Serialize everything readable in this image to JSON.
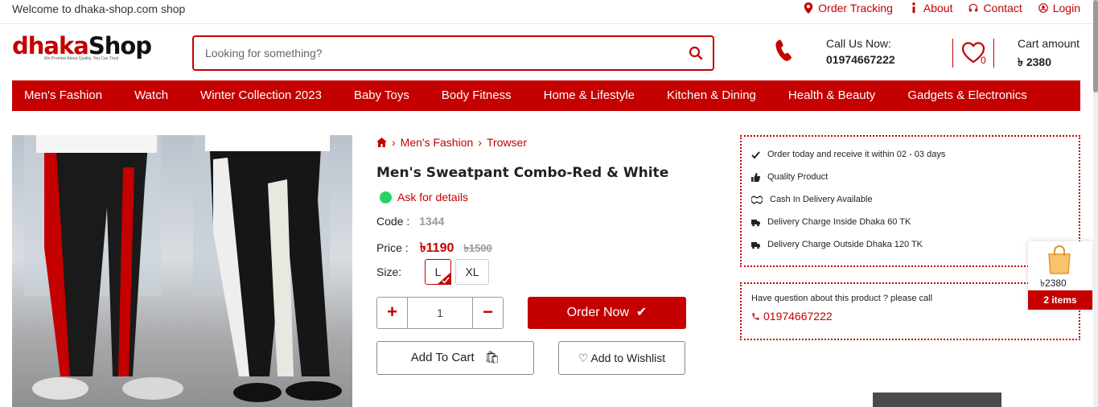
{
  "topbar": {
    "welcome": "Welcome to dhaka-shop.com shop",
    "links": [
      {
        "label": "Order Tracking",
        "icon": "map-marker-icon"
      },
      {
        "label": "About",
        "icon": "info-icon"
      },
      {
        "label": "Contact",
        "icon": "headset-icon"
      },
      {
        "label": "Login",
        "icon": "user-icon"
      }
    ]
  },
  "header": {
    "logo_part1": "dhaka",
    "logo_part2": "Shop",
    "logo_tagline": "We Promise About Quality, You Can Trust",
    "search_placeholder": "Looking for something?",
    "call_label": "Call Us Now:",
    "call_number": "01974667222",
    "wishlist_count": "0",
    "cart_label": "Cart amount",
    "cart_value": "৳ 2380"
  },
  "nav": {
    "items": [
      "Men's Fashion",
      "Watch",
      "Winter Collection 2023",
      "Baby Toys",
      "Body Fitness",
      "Home & Lifestyle",
      "Kitchen & Dining",
      "Health & Beauty",
      "Gadgets & Electronics"
    ]
  },
  "product": {
    "breadcrumb": [
      "Men's Fashion",
      "Trowser"
    ],
    "title": "Men's Sweatpant Combo-Red & White",
    "ask": "Ask for details",
    "code_label": "Code :",
    "code_value": "1344",
    "price_label": "Price :",
    "price_value": "৳1190",
    "old_price": "৳1500",
    "size_label": "Size:",
    "sizes": [
      "L",
      "XL"
    ],
    "selected_size": "L",
    "quantity": "1",
    "order_now": "Order Now",
    "add_to_cart": "Add To Cart",
    "add_to_wishlist": "Add to Wishlist"
  },
  "features": [
    {
      "text": "Order today and receive it within 02 - 03 days",
      "icon": "check-icon"
    },
    {
      "text": "Quality Product",
      "icon": "thumbs-up-icon"
    },
    {
      "text": "Cash In Delivery Available",
      "icon": "handshake-icon"
    },
    {
      "text": "Delivery Charge Inside Dhaka 60 TK",
      "icon": "truck-icon"
    },
    {
      "text": "Delivery Charge Outside Dhaka 120 TK",
      "icon": "truck-icon"
    }
  ],
  "question": {
    "text": "Have question about this product ? please call",
    "phone": "01974667222"
  },
  "floating_cart": {
    "amount": "৳2380",
    "items": "2 items"
  },
  "colors": {
    "brand": "#c40000",
    "text": "#222222",
    "muted": "#999999"
  }
}
